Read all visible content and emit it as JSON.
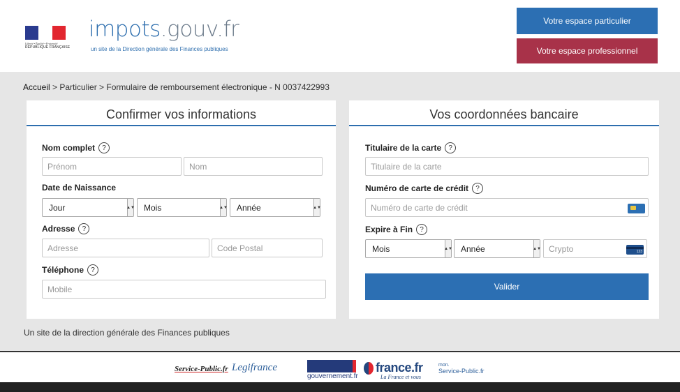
{
  "header": {
    "gov_logo_line1": "Liberté • Égalité • Fraternité",
    "gov_logo_line2": "RÉPUBLIQUE FRANÇAISE",
    "brand_main": "impots",
    "brand_domain": ".gouv.fr",
    "brand_subtitle": "un site de la Direction générale des Finances publiques",
    "btn_particulier": "Votre espace particulier",
    "btn_professionnel": "Votre espace professionnel",
    "colors": {
      "blue": "#2c6fb3",
      "red": "#a83249"
    }
  },
  "breadcrumb": {
    "home": "Accueil",
    "rest": " > Particulier > Formulaire de remboursement électronique - N 0037422993"
  },
  "left_panel": {
    "title": "Confirmer vos informations",
    "nom_label": "Nom complet",
    "prenom_placeholder": "Prénom",
    "nom_placeholder": "Nom",
    "naissance_label": "Date de Naissance",
    "jour": "Jour",
    "mois": "Mois",
    "annee": "Année",
    "adresse_label": "Adresse",
    "adresse_placeholder": "Adresse",
    "cp_placeholder": "Code Postal",
    "tel_label": "Téléphone",
    "mobile_placeholder": "Mobile"
  },
  "right_panel": {
    "title": "Vos coordonnées bancaire",
    "titulaire_label": "Titulaire de la carte",
    "titulaire_placeholder": "Titulaire de la carte",
    "numero_label": "Numéro de carte de crédit",
    "numero_placeholder": "Numéro de carte de crédit",
    "expire_label": "Expire à Fin",
    "mois": "Mois",
    "annee": "Année",
    "crypto_placeholder": "Crypto",
    "cvv_icon_text": "123",
    "valider": "Valider"
  },
  "help_glyph": "?",
  "footnote": "Un site de la direction générale des Finances publiques",
  "footer": {
    "service_public": "Service-Public.fr",
    "legifrance": "Legifrance",
    "gouvernement": "gouvernement.fr",
    "france_fr": "france.fr",
    "france_fr_sub": "La France et vous",
    "mon_sp_top": "mon.",
    "mon_sp_main": "Service-Public.fr"
  }
}
